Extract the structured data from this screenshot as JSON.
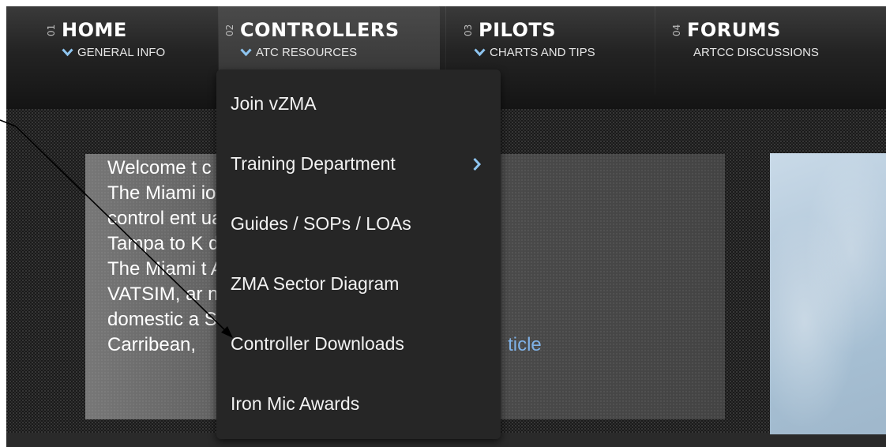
{
  "nav": {
    "items": [
      {
        "num": "01",
        "title": "HOME",
        "sub": "GENERAL INFO",
        "has_chevron": true
      },
      {
        "num": "02",
        "title": "CONTROLLERS",
        "sub": "ATC RESOURCES",
        "has_chevron": true
      },
      {
        "num": "03",
        "title": "PILOTS",
        "sub": "CHARTS AND TIPS",
        "has_chevron": true
      },
      {
        "num": "04",
        "title": "FORUMS",
        "sub": "ARTCC DISCUSSIONS",
        "has_chevron": false
      }
    ]
  },
  "dropdown": {
    "items": [
      {
        "label": "Join vZMA",
        "has_submenu": false
      },
      {
        "label": "Training Department",
        "has_submenu": true
      },
      {
        "label": "Guides / SOPs / LOAs",
        "has_submenu": false
      },
      {
        "label": "ZMA Sector Diagram",
        "has_submenu": false
      },
      {
        "label": "Controller Downloads",
        "has_submenu": false
      },
      {
        "label": "Iron Mic Awards",
        "has_submenu": false
      }
    ]
  },
  "welcome": {
    "lines": [
      "Welcome t                              c Control Center!",
      "The Miami                              ion and air traffic",
      "control ent                              ual skies from",
      "Tampa to K                              d over the Bahamas.",
      "The Miami                              t ARTCCs on",
      "VATSIM, ar                              nation for both",
      "domestic a                              South America, the"
    ],
    "last_line_start": "Carribean,",
    "read_more": "ticle"
  },
  "colors": {
    "nav_bg": "#1f1f1f",
    "dropdown_bg": "#262626",
    "link": "#7fb1e6",
    "chevron": "#8ec5f0"
  }
}
